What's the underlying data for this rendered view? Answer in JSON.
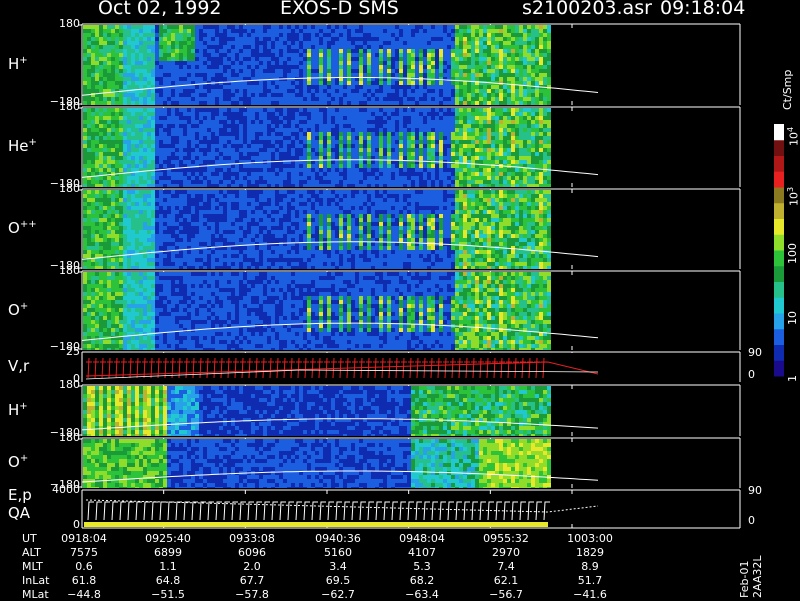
{
  "header": {
    "date": "Oct 02, 1992",
    "instrument": "EXOS-D SMS",
    "file": "s2100203.asr",
    "time": "09:18:04"
  },
  "panels": [
    {
      "label": "H",
      "sup": "+",
      "ytop": "180",
      "ybot": "−180"
    },
    {
      "label": "He",
      "sup": "+",
      "ytop": "180",
      "ybot": "−180"
    },
    {
      "label": "O",
      "sup": "++",
      "ytop": "180",
      "ybot": "−180"
    },
    {
      "label": "O",
      "sup": "+",
      "ytop": "180",
      "ybot": "−180"
    },
    {
      "label": "V,r",
      "sup": "",
      "ytop": "25",
      "ybot": "0",
      "rtop": "90",
      "rbot": "0"
    },
    {
      "label": "H",
      "sup": "+",
      "ytop": "180",
      "ybot": "−180"
    },
    {
      "label": "O",
      "sup": "+",
      "ytop": "180",
      "ybot": "−180"
    },
    {
      "label": "E,p",
      "label2": "QA",
      "sup": "",
      "ytop": "4000",
      "ybot": "0",
      "rtop": "90",
      "rbot": "0"
    }
  ],
  "colorbar": {
    "unit": "Ct/Smp",
    "ticks": [
      {
        "base": "10",
        "exp": "4"
      },
      {
        "base": "10",
        "exp": "3"
      },
      {
        "base": "100",
        "exp": ""
      },
      {
        "base": "10",
        "exp": ""
      },
      {
        "base": "1",
        "exp": ""
      }
    ],
    "colors": [
      "#1a0a8c",
      "#0f2bb0",
      "#1b5fe0",
      "#27a2e8",
      "#20c8d0",
      "#26c08a",
      "#1b9a3a",
      "#2cc23a",
      "#8fdc2a",
      "#e8e82a",
      "#c0b030",
      "#8b7a20",
      "#e82020",
      "#b01818",
      "#701010",
      "#ffffff"
    ]
  },
  "chart_data": {
    "type": "heatmap",
    "title": "Oct 02, 1992   EXOS-D SMS",
    "x_ticks": [
      "0918:04",
      "0925:40",
      "0933:08",
      "0940:36",
      "0948:04",
      "0955:32",
      "1003:00"
    ],
    "panels": [
      "H+",
      "He+",
      "O++",
      "O+",
      "V,r",
      "H+",
      "O+",
      "E,p QA"
    ],
    "ylim_angle": [
      -180,
      180
    ],
    "vr_ylim": [
      0,
      25
    ],
    "ep_ylim": [
      0,
      4000
    ],
    "color_scale": "log",
    "color_range": [
      1,
      10000
    ]
  },
  "footer": {
    "rows": [
      {
        "name": "UT",
        "values": [
          "0918:04",
          "0925:40",
          "0933:08",
          "0940:36",
          "0948:04",
          "0955:32",
          "1003:00"
        ]
      },
      {
        "name": "ALT",
        "values": [
          "7575",
          "6899",
          "6096",
          "5160",
          "4107",
          "2970",
          "1829"
        ]
      },
      {
        "name": "MLT",
        "values": [
          "0.6",
          "1.1",
          "2.0",
          "3.4",
          "5.3",
          "7.4",
          "8.9"
        ]
      },
      {
        "name": "InLat",
        "values": [
          "61.8",
          "64.8",
          "67.7",
          "69.5",
          "68.2",
          "62.1",
          "51.7"
        ]
      },
      {
        "name": "MLat",
        "values": [
          "−44.8",
          "−51.5",
          "−57.8",
          "−62.7",
          "−63.4",
          "−56.7",
          "−41.6"
        ]
      }
    ],
    "side": "Feb-01  2AA32L"
  }
}
